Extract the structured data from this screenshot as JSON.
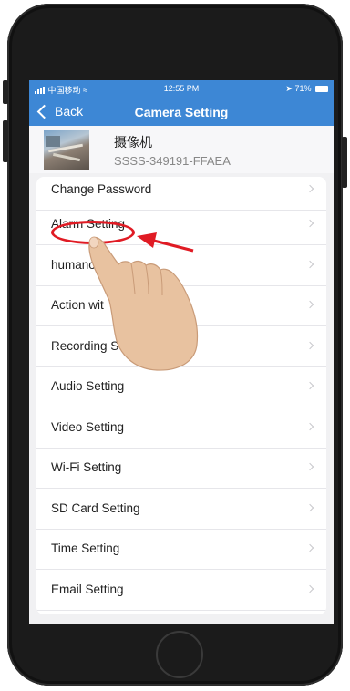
{
  "status_bar": {
    "carrier": "中国移动",
    "time": "12:55 PM",
    "battery": "71%"
  },
  "nav": {
    "back_label": "Back",
    "title": "Camera Setting"
  },
  "device": {
    "name": "摄像机",
    "id": "SSSS-349191-FFAEA"
  },
  "settings": [
    "Change Password",
    "Alarm Setting",
    "humanoi",
    "Action wit",
    "Recording Sch",
    "Audio Setting",
    "Video Setting",
    "Wi-Fi Setting",
    "SD Card Setting",
    "Time Setting",
    "Email Setting"
  ],
  "annotation": {
    "highlight_color": "#e01b24",
    "highlighted_item": "Alarm Setting"
  },
  "colors": {
    "nav_bar": "#3d87d5",
    "background": "#f1f1f3"
  }
}
